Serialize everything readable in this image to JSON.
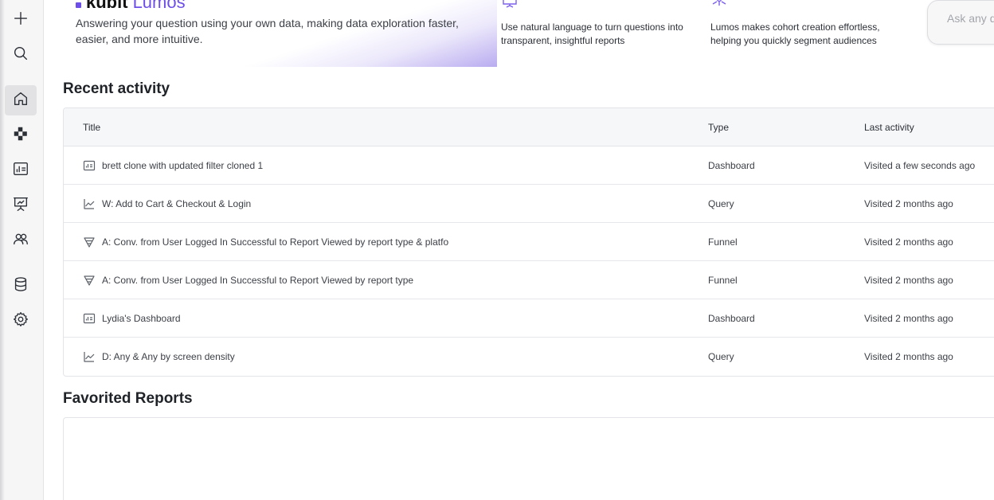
{
  "sidebar": {
    "items": [
      {
        "name": "new",
        "icon": "plus-icon",
        "active": false
      },
      {
        "name": "search",
        "icon": "search-icon",
        "active": false
      },
      {
        "name": "home",
        "icon": "home-icon",
        "active": true
      },
      {
        "name": "cohorts",
        "icon": "blocks-icon",
        "active": false
      },
      {
        "name": "dashboards",
        "icon": "dashboard-icon",
        "active": false
      },
      {
        "name": "presentations",
        "icon": "presentation-icon",
        "active": false
      },
      {
        "name": "users",
        "icon": "users-icon",
        "active": false
      },
      {
        "name": "data",
        "icon": "database-icon",
        "active": false
      },
      {
        "name": "settings",
        "icon": "gear-icon",
        "active": false
      }
    ]
  },
  "hero": {
    "brand": "kubit",
    "product": "Lumos",
    "description": "Answering your question using your own data, making data exploration faster, easier, and more intuitive.",
    "features": [
      {
        "icon": "chart-report-icon",
        "text_line1": "Use natural language to turn questions into",
        "text_line2": "transparent, insightful reports"
      },
      {
        "icon": "cohort-icon",
        "text_line1": "Lumos makes cohort creation effortless,",
        "text_line2": "helping you quickly segment audiences"
      }
    ],
    "ask_placeholder": "Ask any question"
  },
  "recent": {
    "title": "Recent activity",
    "columns": {
      "title": "Title",
      "type": "Type",
      "last_activity": "Last activity"
    },
    "rows": [
      {
        "icon": "dashboard-icon",
        "title": "brett clone with updated filter cloned 1",
        "type": "Dashboard",
        "last": "Visited a few seconds ago"
      },
      {
        "icon": "line-chart-icon",
        "title": "W: Add to Cart & Checkout & Login",
        "type": "Query",
        "last": "Visited 2 months ago"
      },
      {
        "icon": "funnel-icon",
        "title": "A: Conv. from User Logged In Successful to Report Viewed by report type & platfo",
        "type": "Funnel",
        "last": "Visited 2 months ago"
      },
      {
        "icon": "funnel-icon",
        "title": "A: Conv. from User Logged In Successful to Report Viewed by report type",
        "type": "Funnel",
        "last": "Visited 2 months ago"
      },
      {
        "icon": "dashboard-icon",
        "title": "Lydia's Dashboard",
        "type": "Dashboard",
        "last": "Visited 2 months ago"
      },
      {
        "icon": "line-chart-icon",
        "title": "D: Any & Any by screen density",
        "type": "Query",
        "last": "Visited 2 months ago"
      }
    ]
  },
  "favorites": {
    "title": "Favorited Reports"
  },
  "colors": {
    "accent": "#6d4ee8",
    "rail_bg": "#f6f6f7",
    "active_bg": "#e2e2e5"
  }
}
